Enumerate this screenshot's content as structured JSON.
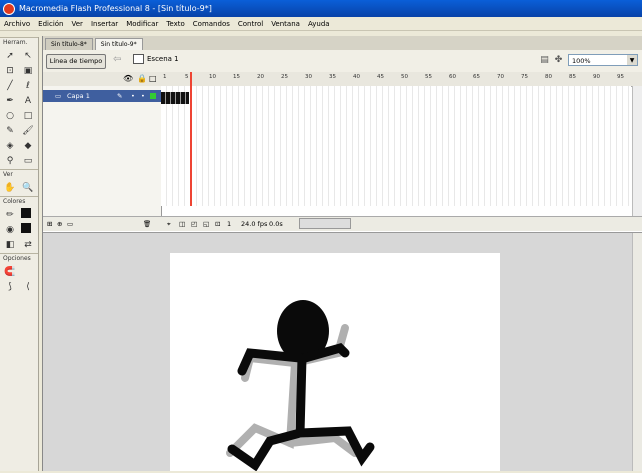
{
  "window": {
    "title": "Macromedia Flash Professional 8 - [Sin título-9*]"
  },
  "menu": [
    "Archivo",
    "Edición",
    "Ver",
    "Insertar",
    "Modificar",
    "Texto",
    "Comandos",
    "Control",
    "Ventana",
    "Ayuda"
  ],
  "tools": {
    "sections": {
      "tools": "Herram.",
      "view": "Ver",
      "colors": "Colores",
      "options": "Opciones"
    }
  },
  "doc": {
    "tabs": [
      "Sin título-8*",
      "Sin título-9*"
    ],
    "timeline_button": "Línea de tiempo",
    "scene": "Escena 1",
    "zoom": "100%"
  },
  "timeline": {
    "layer": "Capa 1",
    "ruler": [
      "1",
      "5",
      "10",
      "15",
      "20",
      "25",
      "30",
      "35",
      "40",
      "45",
      "50",
      "55",
      "60",
      "65",
      "70",
      "75",
      "80",
      "85",
      "90",
      "95"
    ],
    "current_frame": "1",
    "fps": "24.0 fps",
    "time": "0.0s"
  },
  "colors": {
    "accent": "#0842a8",
    "layer_selected": "#3f5f9f",
    "playhead": "#ee4433"
  }
}
